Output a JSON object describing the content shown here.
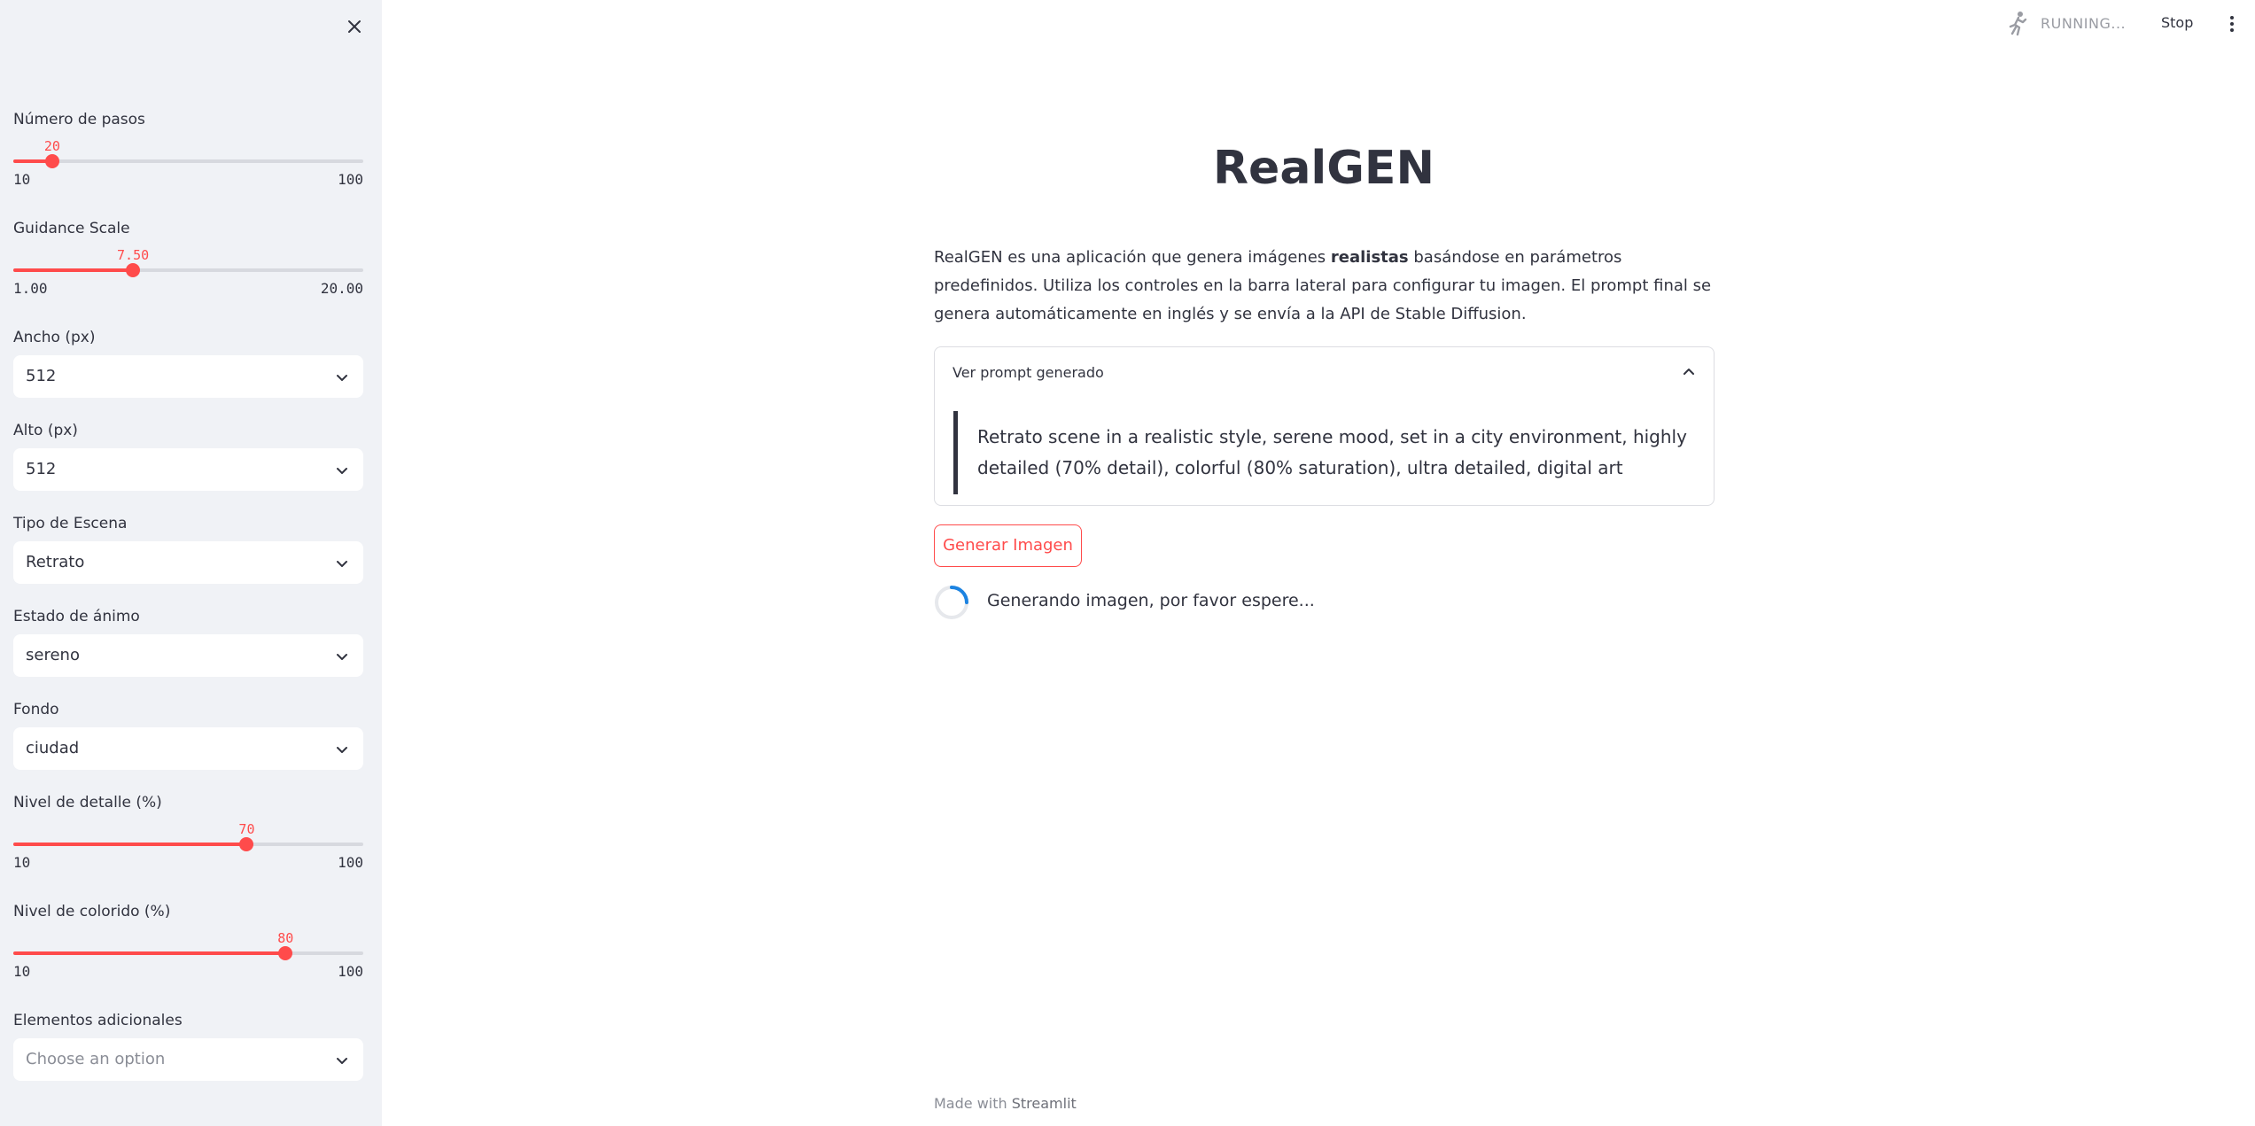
{
  "sidebar": {
    "sliders": [
      {
        "label": "Número de pasos",
        "value": "20",
        "min": "10",
        "max": "100",
        "fraction": 0.111
      },
      {
        "label": "Guidance Scale",
        "value": "7.50",
        "min": "1.00",
        "max": "20.00",
        "fraction": 0.342
      },
      {
        "label": "Nivel de detalle (%)",
        "value": "70",
        "min": "10",
        "max": "100",
        "fraction": 0.667
      },
      {
        "label": "Nivel de colorido (%)",
        "value": "80",
        "min": "10",
        "max": "100",
        "fraction": 0.778
      }
    ],
    "selects": [
      {
        "label": "Ancho (px)",
        "value": "512"
      },
      {
        "label": "Alto (px)",
        "value": "512"
      },
      {
        "label": "Tipo de Escena",
        "value": "Retrato"
      },
      {
        "label": "Estado de ánimo",
        "value": "sereno"
      },
      {
        "label": "Fondo",
        "value": "ciudad"
      },
      {
        "label": "Elementos adicionales",
        "value": "Choose an option"
      }
    ]
  },
  "status": {
    "running_text": "RUNNING...",
    "stop_label": "Stop"
  },
  "main": {
    "title": "RealGEN",
    "desc": {
      "part1": "RealGEN es una aplicación que genera imágenes ",
      "bold": "realistas",
      "part2": " basándose en parámetros predefinidos. Utiliza los controles en la barra lateral para configurar tu imagen. El prompt final se genera automáticamente en inglés y se envía a la API de Stable Diffusion."
    },
    "expander": {
      "label": "Ver prompt generado",
      "prompt": "Retrato scene in a realistic style, serene mood, set in a city environment, highly detailed (70% detail), colorful (80% saturation), ultra detailed, digital art"
    },
    "generate_label": "Generar Imagen",
    "spinner_text": "Generando imagen, por favor espere..."
  },
  "footer": {
    "prefix": "Made with ",
    "brand": "Streamlit"
  },
  "colors": {
    "accent": "#ff4b4b",
    "sidebar_bg": "#f0f2f6",
    "text": "#31333f",
    "spinner": "#1c83e1"
  },
  "icons": {
    "close": "close-icon",
    "chevron": "chevron-down-icon",
    "running": "running-man-icon",
    "menu": "kebab-menu-icon"
  }
}
